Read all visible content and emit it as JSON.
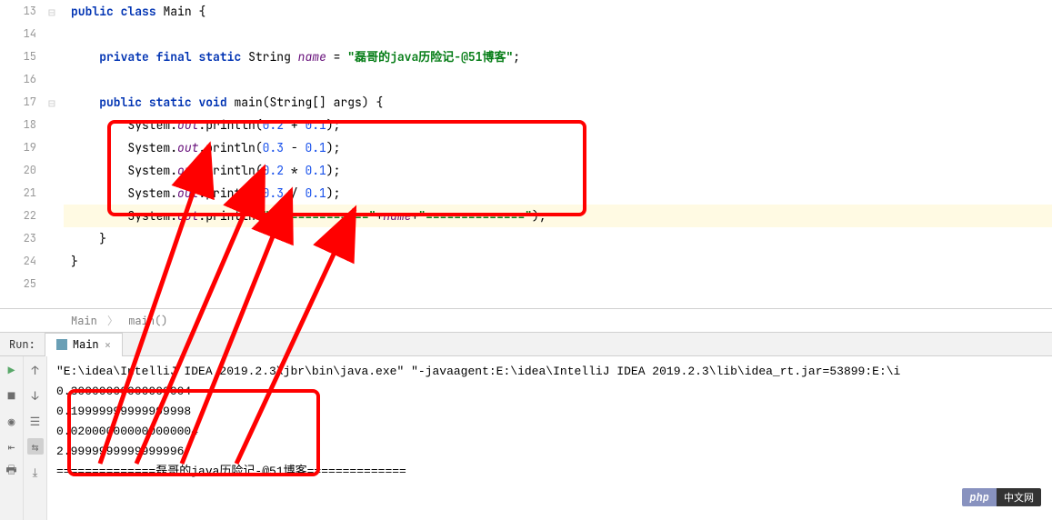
{
  "gutter": {
    "start": 13,
    "end": 25
  },
  "run_markers": [
    13,
    17
  ],
  "code": {
    "l13": {
      "indent": "",
      "parts": [
        [
          "kw",
          "public"
        ],
        [
          "",
          " "
        ],
        [
          "kw",
          "class"
        ],
        [
          "",
          " Main {"
        ]
      ]
    },
    "l14": {
      "indent": "",
      "parts": []
    },
    "l15": {
      "indent": "    ",
      "parts": [
        [
          "kw",
          "private"
        ],
        [
          "",
          " "
        ],
        [
          "kw",
          "final"
        ],
        [
          "",
          " "
        ],
        [
          "kw",
          "static"
        ],
        [
          "",
          " String "
        ],
        [
          "field-static",
          "name"
        ],
        [
          "",
          " = "
        ],
        [
          "str",
          "\"磊哥的java历险记-@51博客\""
        ],
        [
          "",
          ";"
        ]
      ]
    },
    "l16": {
      "indent": "",
      "parts": []
    },
    "l17": {
      "indent": "    ",
      "parts": [
        [
          "kw",
          "public"
        ],
        [
          "",
          " "
        ],
        [
          "kw",
          "static"
        ],
        [
          "",
          " "
        ],
        [
          "kw",
          "void"
        ],
        [
          "",
          " main(String[] args) {"
        ]
      ]
    },
    "l18": {
      "indent": "        ",
      "parts": [
        [
          "",
          "System."
        ],
        [
          "field-static",
          "out"
        ],
        [
          "",
          ".println("
        ],
        [
          "num",
          "0.2"
        ],
        [
          "",
          " + "
        ],
        [
          "num",
          "0.1"
        ],
        [
          "",
          ");"
        ]
      ]
    },
    "l19": {
      "indent": "        ",
      "parts": [
        [
          "",
          "System."
        ],
        [
          "field-static",
          "out"
        ],
        [
          "",
          ".println("
        ],
        [
          "num",
          "0.3"
        ],
        [
          "",
          " - "
        ],
        [
          "num",
          "0.1"
        ],
        [
          "",
          ");"
        ]
      ]
    },
    "l20": {
      "indent": "        ",
      "parts": [
        [
          "",
          "System."
        ],
        [
          "field-static",
          "out"
        ],
        [
          "",
          ".println("
        ],
        [
          "num",
          "0.2"
        ],
        [
          "",
          " * "
        ],
        [
          "num",
          "0.1"
        ],
        [
          "",
          ");"
        ]
      ]
    },
    "l21": {
      "indent": "        ",
      "parts": [
        [
          "",
          "System."
        ],
        [
          "field-static",
          "out"
        ],
        [
          "",
          ".println("
        ],
        [
          "num",
          "0.3"
        ],
        [
          "",
          " / "
        ],
        [
          "num",
          "0.1"
        ],
        [
          "",
          ");"
        ]
      ]
    },
    "l22": {
      "indent": "        ",
      "highlight": true,
      "parts": [
        [
          "",
          "System."
        ],
        [
          "field-static",
          "out"
        ],
        [
          "",
          ".println("
        ],
        [
          "str",
          "\"==============\""
        ],
        [
          "",
          "+"
        ],
        [
          "field-static",
          "name"
        ],
        [
          "",
          "+"
        ],
        [
          "str",
          "\"==============\""
        ],
        [
          "",
          ");"
        ]
      ]
    },
    "l23": {
      "indent": "    ",
      "parts": [
        [
          "",
          "}"
        ]
      ]
    },
    "l24": {
      "indent": "",
      "parts": [
        [
          "",
          "}"
        ]
      ]
    },
    "l25": {
      "indent": "",
      "parts": []
    }
  },
  "breadcrumb": {
    "class": "Main",
    "method": "main()"
  },
  "run": {
    "label": "Run:",
    "tab": "Main",
    "console_lines": [
      "\"E:\\idea\\IntelliJ IDEA 2019.2.3\\jbr\\bin\\java.exe\" \"-javaagent:E:\\idea\\IntelliJ IDEA 2019.2.3\\lib\\idea_rt.jar=53899:E:\\i",
      "0.30000000000000004",
      "0.19999999999999998",
      "0.020000000000000004",
      "2.9999999999999996",
      "==============磊哥的java历险记-@51博客=============="
    ]
  },
  "watermark": {
    "php": "php",
    "cn": "中文网"
  }
}
